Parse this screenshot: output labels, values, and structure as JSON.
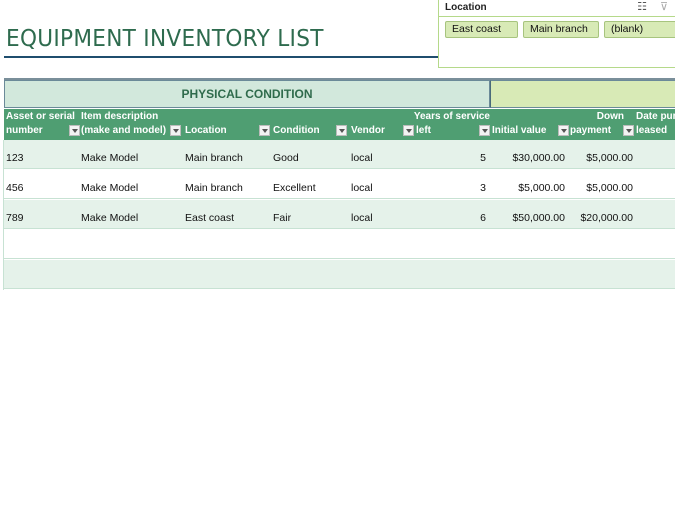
{
  "title": "EQUIPMENT INVENTORY LIST",
  "slicer": {
    "header": "Location",
    "icons": [
      "multi-select-icon",
      "clear-filter-icon"
    ],
    "items": [
      "East coast",
      "Main branch",
      "(blank)"
    ]
  },
  "groups": {
    "physical": "PHYSICAL CONDITION",
    "financial": ""
  },
  "columns": [
    {
      "line1": "Asset or serial",
      "line2": "number"
    },
    {
      "line1": "Item description",
      "line2": "(make and model)"
    },
    {
      "line1": "",
      "line2": "Location"
    },
    {
      "line1": "",
      "line2": "Condition"
    },
    {
      "line1": "",
      "line2": "Vendor"
    },
    {
      "line1": "Years of service",
      "line2": "left"
    },
    {
      "line1": "",
      "line2": "Initial value"
    },
    {
      "line1": "Down",
      "line2": "payment"
    },
    {
      "line1": "Date pur",
      "line2": "leased"
    }
  ],
  "rows": [
    {
      "asset": "123",
      "item": "Make Model",
      "location": "Main branch",
      "condition": "Good",
      "vendor": "local",
      "years": "5",
      "initial": "$30,000.00",
      "down": "$5,000.00"
    },
    {
      "asset": "456",
      "item": "Make Model",
      "location": "Main branch",
      "condition": "Excellent",
      "vendor": "local",
      "years": "3",
      "initial": "$5,000.00",
      "down": "$5,000.00"
    },
    {
      "asset": "789",
      "item": "Make Model",
      "location": "East coast",
      "condition": "Fair",
      "vendor": "local",
      "years": "6",
      "initial": "$50,000.00",
      "down": "$20,000.00"
    },
    {
      "asset": "",
      "item": "",
      "location": "",
      "condition": "",
      "vendor": "",
      "years": "",
      "initial": "",
      "down": ""
    },
    {
      "asset": "",
      "item": "",
      "location": "",
      "condition": "",
      "vendor": "",
      "years": "",
      "initial": "",
      "down": ""
    }
  ]
}
